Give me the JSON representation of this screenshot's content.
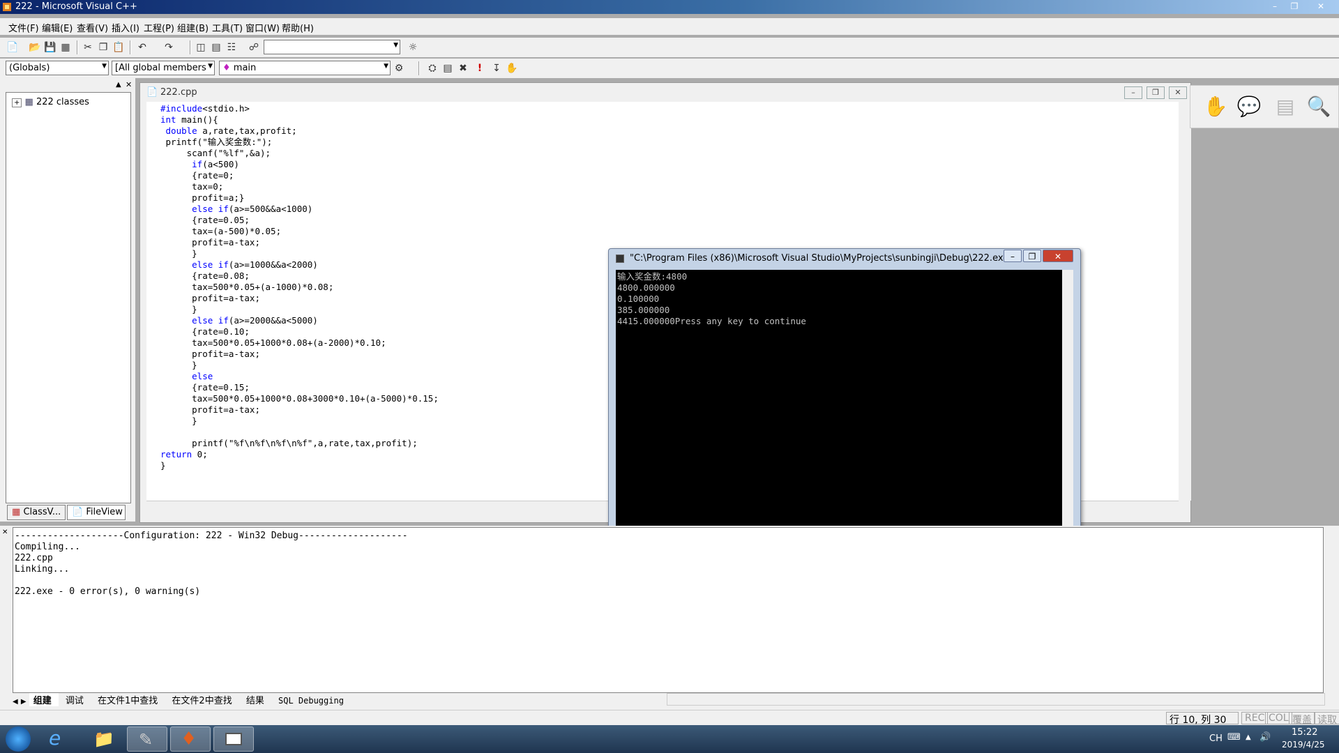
{
  "window": {
    "title": "222 - Microsoft Visual C++"
  },
  "menu": [
    "文件(F)",
    "编辑(E)",
    "查看(V)",
    "插入(I)",
    "工程(P)",
    "组建(B)",
    "工具(T)",
    "窗口(W)",
    "帮助(H)"
  ],
  "toolbar2": {
    "globals": "(Globals)",
    "members": "[All global members",
    "function": "main"
  },
  "workspace": {
    "tree_root": "222 classes",
    "tab_class": "ClassV...",
    "tab_file": "FileView"
  },
  "editor": {
    "title": "222.cpp",
    "lines": [
      "#include<stdio.h>",
      "int main(){",
      " double a,rate,tax,profit;",
      " printf(\"输入奖金数:\");",
      "     scanf(\"%lf\",&a);",
      "      if(a<500)",
      "      {rate=0;",
      "      tax=0;",
      "      profit=a;}",
      "      else if(a>=500&&a<1000)",
      "      {rate=0.05;",
      "      tax=(a-500)*0.05;",
      "      profit=a-tax;",
      "      }",
      "      else if(a>=1000&&a<2000)",
      "      {rate=0.08;",
      "      tax=500*0.05+(a-1000)*0.08;",
      "      profit=a-tax;",
      "      }",
      "      else if(a>=2000&&a<5000)",
      "      {rate=0.10;",
      "      tax=500*0.05+1000*0.08+(a-2000)*0.10;",
      "      profit=a-tax;",
      "      }",
      "      else",
      "      {rate=0.15;",
      "      tax=500*0.05+1000*0.08+3000*0.10+(a-5000)*0.15;",
      "      profit=a-tax;",
      "      }",
      "",
      "      printf(\"%f\\n%f\\n%f\\n%f\",a,rate,tax,profit);",
      "return 0;",
      "}"
    ]
  },
  "console": {
    "title": "\"C:\\Program Files (x86)\\Microsoft Visual Studio\\MyProjects\\sunbingji\\Debug\\222.exe\"",
    "lines": [
      "输入奖金数:4800",
      "4800.000000",
      "0.100000",
      "385.000000",
      "4415.000000Press any key to continue"
    ]
  },
  "output": {
    "lines": [
      "--------------------Configuration: 222 - Win32 Debug--------------------",
      "Compiling...",
      "222.cpp",
      "Linking...",
      "",
      "222.exe - 0 error(s), 0 warning(s)"
    ],
    "tabs": [
      "组建",
      "调试",
      "在文件1中查找",
      "在文件2中查找",
      "结果",
      "SQL Debugging"
    ]
  },
  "status": {
    "position": "行 10, 列 30",
    "rec": "REC",
    "col": "COL",
    "ovr": "覆盖",
    "read": "读取"
  },
  "taskbar": {
    "time": "15:22",
    "date": "2019/4/25",
    "lang": "CH"
  }
}
